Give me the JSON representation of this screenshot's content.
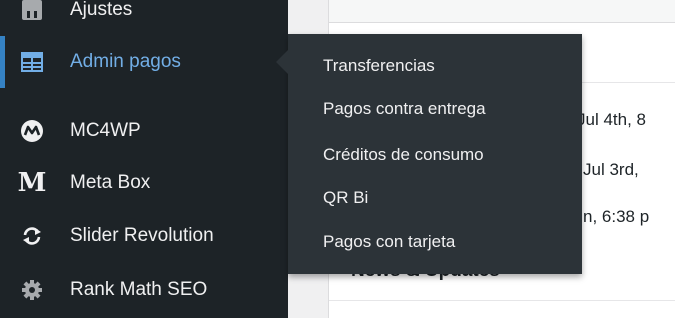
{
  "sidebar": {
    "items": [
      {
        "label": "Ajustes",
        "icon": "settings-icon"
      },
      {
        "label": "Admin pagos",
        "icon": "table-icon",
        "active": true
      },
      {
        "label": "MC4WP",
        "icon": "mc4wp-logo-icon"
      },
      {
        "label": "Meta Box",
        "icon": "meta-box-icon",
        "glyph": "M"
      },
      {
        "label": "Slider Revolution",
        "icon": "refresh-icon"
      },
      {
        "label": "Rank Math SEO",
        "icon": "gear-icon"
      }
    ]
  },
  "flyout": {
    "items": [
      "Transferencias",
      "Pagos contra entrega",
      "Créditos de consumo",
      "QR Bi",
      "Pagos con tarjeta"
    ]
  },
  "main": {
    "activity": [
      "Jul 4th, 8",
      "Jul 3rd,",
      "n, 6:38 p"
    ],
    "news_title": "News & Updates"
  },
  "colors": {
    "sidebar_bg": "#1d2327",
    "flyout_bg": "#2c3338",
    "active_accent": "#72aee6",
    "active_bar": "#3582c4"
  }
}
